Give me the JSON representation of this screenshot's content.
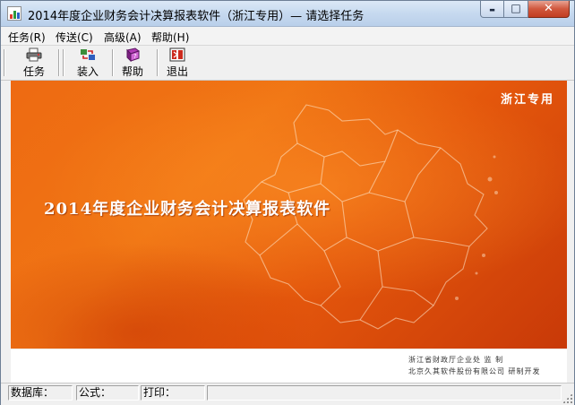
{
  "window": {
    "title": "2014年度企业财务会计决算报表软件（浙江专用）— 请选择任务",
    "minimize_glyph": "▬",
    "maximize_glyph": "□",
    "close_glyph": "✕"
  },
  "menu": {
    "items": [
      {
        "label": "任务(R)"
      },
      {
        "label": "传送(C)"
      },
      {
        "label": "高级(A)"
      },
      {
        "label": "帮助(H)"
      }
    ]
  },
  "toolbar": {
    "items": [
      {
        "label": "任务",
        "icon": "printer-task-icon"
      },
      {
        "label": "装入",
        "icon": "load-arrows-icon"
      },
      {
        "label": "帮助",
        "icon": "help-book-icon"
      },
      {
        "label": "退出",
        "icon": "exit-door-icon"
      }
    ]
  },
  "banner": {
    "tag": "浙江专用",
    "title": "2014年度企业财务会计决算报表软件",
    "colors": {
      "primary": "#ee6a12",
      "dark": "#c83908"
    }
  },
  "credits": {
    "line1": "浙江省财政厅企业处  监  制",
    "line2": "北京久其软件股份有限公司  研制开发"
  },
  "status": {
    "database_label": "数据库：",
    "formula_label": "公式：",
    "print_label": "打印："
  }
}
